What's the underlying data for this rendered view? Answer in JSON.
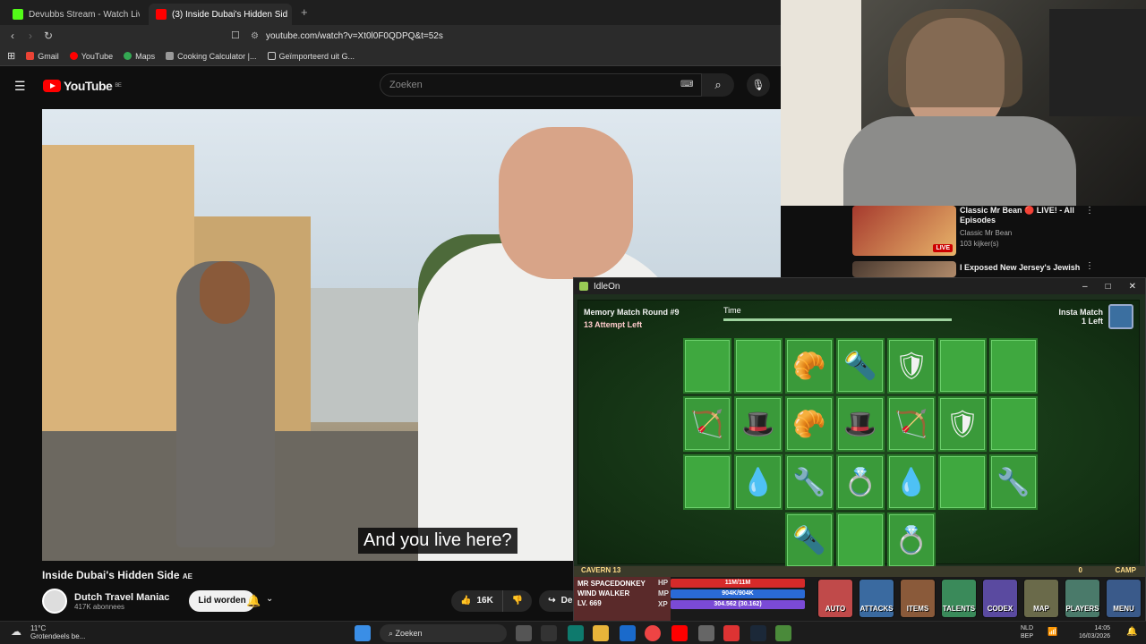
{
  "browser": {
    "tabs": [
      {
        "label": "Devubbs Stream - Watch Live on",
        "active": false
      },
      {
        "label": "(3) Inside Dubai's Hidden Sid",
        "active": true
      }
    ],
    "new_tab": "+",
    "url": "youtube.com/watch?v=Xt0l0F0QDPQ&t=52s",
    "bookmarks": [
      "Gmail",
      "YouTube",
      "Maps",
      "Cooking Calculator |...",
      "Geïmporteerd uit G..."
    ]
  },
  "youtube": {
    "logo": "YouTube",
    "logo_suffix": "BE",
    "search_placeholder": "Zoeken",
    "caption": "And you live here?",
    "video_title": "Inside Dubai's Hidden Side",
    "video_title_badge": "AE",
    "channel_name": "Dutch Travel Maniac",
    "subscribers": "417K abonnees",
    "join_label": "Lid worden",
    "likes": "16K",
    "share_label": "De",
    "recommended": [
      {
        "title": "Classic Mr Bean 🔴 LIVE! - All Episodes",
        "channel": "Classic Mr Bean",
        "meta": "103 kijker(s)",
        "badge": "LIVE"
      },
      {
        "title": "I Exposed New Jersey's Jewish",
        "channel": "",
        "meta": "",
        "badge": ""
      }
    ]
  },
  "idleon": {
    "window_title": "IdleOn",
    "round": "Memory Match Round #9",
    "attempts": "13 Attempt Left",
    "time_label": "Time",
    "time_remaining": 0.85,
    "insta_match": "Insta Match",
    "insta_left": "1 Left",
    "grid": [
      [
        "",
        "",
        "🥐",
        "🔦",
        "🛡",
        "",
        ""
      ],
      [
        "🏹",
        "🎩",
        "🥐",
        "🎩",
        "🏹",
        "🛡",
        ""
      ],
      [
        "",
        "💧",
        "🔧",
        "💍",
        "💧",
        "",
        "🔧"
      ],
      [
        null,
        null,
        "🔦",
        "",
        "💍",
        null,
        null
      ]
    ],
    "hud": {
      "location": "CAVERN 13",
      "camp": "CAMP",
      "player_name": "MR SPACEDONKEY",
      "player_class": "WIND WALKER",
      "level": "LV. 669",
      "hp_label": "HP",
      "mp_label": "MP",
      "xp_label": "XP",
      "hp": "11M/11M",
      "mp": "904K/904K",
      "xp": "304.562 (30.162)",
      "buttons": [
        "AUTO",
        "ATTACKS",
        "ITEMS",
        "TALENTS",
        "CODEX",
        "MAP",
        "PLAYERS",
        "MENU"
      ],
      "counter": "0"
    }
  },
  "taskbar": {
    "weather_temp": "11°C",
    "weather_desc": "Grotendeels be...",
    "search": "Zoeken",
    "lang": "NLD",
    "layout": "BEP",
    "time": "14:05",
    "date": "16/03/2026"
  }
}
